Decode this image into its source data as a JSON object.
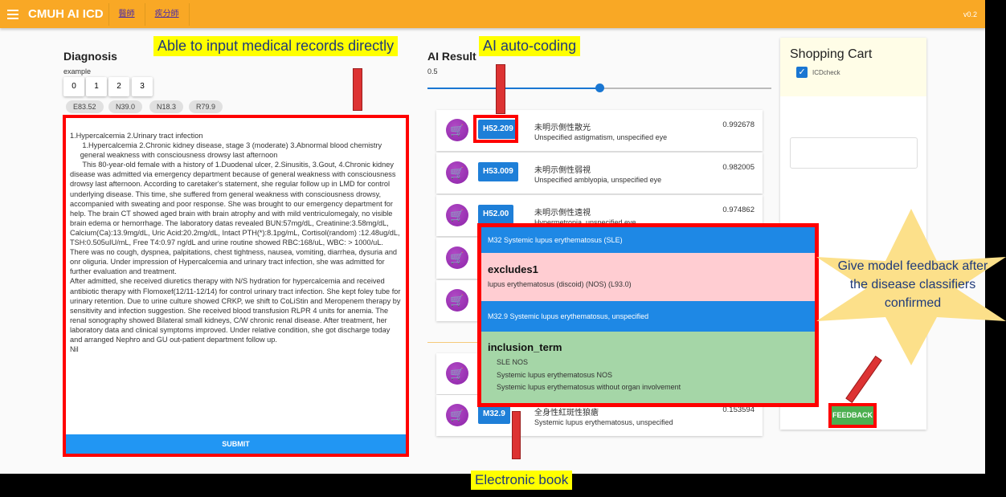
{
  "topbar": {
    "title": "CMUH AI ICD",
    "nav": [
      "醫師",
      "疾分師"
    ],
    "version": "v0.2"
  },
  "diagnosis": {
    "title": "Diagnosis",
    "example_label": "example",
    "examples": [
      "0",
      "1",
      "2",
      "3"
    ],
    "chips": [
      "E83.52",
      "N39.0",
      "N18.3",
      "R79.9"
    ],
    "text": "1.Hypercalcemia 2.Urinary tract infection\n      1.Hypercalcemia 2.Chronic kidney disease, stage 3 (moderate) 3.Abnormal blood chemistry\n     general weakness with consciousness drowsy last afternoon\n      This 80-year-old female with a history of 1.Duodenal ulcer, 2.Sinusitis, 3.Gout, 4.Chronic kidney disease was admitted via emergency department because of general weakness with consciousness drowsy last afternoon. According to caretaker's statement, she regular follow up in LMD for control underlying disease. This time, she suffered from general weakness with consciousness drowsy, accompanied with sweating and poor response. She was brought to our emergency department for help. The brain CT showed aged brain with brain atrophy and with mild ventriculomegaly, no visible brain edema or hemorrhage. The laboratory datas revealed BUN:57mg/dL, Creatinine:3.58mg/dL, Calcium(Ca):13.9mg/dL, Uric Acid:20.2mg/dL, Intact PTH(*):8.1pg/mL, Cortisol(random) :12.48ug/dL, TSH:0.505uIU/mL, Free T4:0.97 ng/dL and urine routine showed RBC:168/uL, WBC: > 1000/uL. There was no cough, dyspnea, palpitations, chest tightness, nausea, vomiting, diarrhea, dysuria and onr oliguria. Under impression of Hypercalcemia and urinary tract infection, she was admitted for further evaluation and treatment.\nAfter admitted, she received diuretics therapy with N/S hydration for hypercalcemia and received antibiotic therapy with Flomoxef(12/11-12/14) for control urinary tract infection. She kept foley tube for urinary retention. Due to urine culture showed CRKP, we shift to CoLiStin and Meropenem therapy by sensitivity and infection suggestion. She received blood transfusion RLPR 4 units for anemia. The renal sonography showed Bilateral small kidneys, C/W chronic renal disease. After treatment, her laboratory data and clinical symptoms improved. Under relative condition, she got discharge today and arranged Nephro and GU out-patient department follow up.\nNil",
    "submit_label": "SUBMIT"
  },
  "ai_result": {
    "title": "AI Result",
    "threshold_label": "0.5",
    "threshold_value": 0.5,
    "results": [
      {
        "code": "H52.209",
        "zh": "未明示側性散光",
        "en": "Unspecified astigmatism, unspecified eye",
        "score": "0.992678"
      },
      {
        "code": "H53.009",
        "zh": "未明示側性弱視",
        "en": "Unspecified amblyopia, unspecified eye",
        "score": "0.982005"
      },
      {
        "code": "H52.00",
        "zh": "未明示側性遠視",
        "en": "Hypermetropia, unspecified eye",
        "score": "0.974862"
      },
      {
        "code": "",
        "zh": "",
        "en": "",
        "score": ""
      },
      {
        "code": "",
        "zh": "",
        "en": "",
        "score": ""
      },
      {
        "code": "",
        "zh": "",
        "en": "",
        "score": ""
      },
      {
        "code": "M32.9",
        "zh": "全身性紅斑性狼瘡",
        "en": "Systemic lupus erythematosus, unspecified",
        "score": "0.153594"
      }
    ]
  },
  "ebook": {
    "parent": "M32 Systemic lupus erythematosus (SLE)",
    "excludes_title": "excludes1",
    "excludes": "lupus erythematosus (discoid) (NOS) (L93.0)",
    "child": "M32.9 Systemic lupus erythematosus, unspecified",
    "inclusion_title": "inclusion_term",
    "inclusions": [
      "SLE NOS",
      "Systemic lupus erythematosus NOS",
      "Systemic lupus erythematosus without organ involvement"
    ]
  },
  "cart": {
    "title": "Shopping Cart",
    "checkbox_label": "ICDcheck",
    "checked": true,
    "input_value": "",
    "feedback_label": "FEEDBACK"
  },
  "annotations": {
    "input": "Able to input medical records directly",
    "autocoding": "AI auto-coding",
    "ebook": "Electronic book",
    "feedback": "Give model feedback after the disease classifiers confirmed"
  },
  "colors": {
    "topbar": "#F9A825",
    "code_badge": "#1E7FD8",
    "cart_button": "#8E24AA",
    "excludes_bg": "#FFCDD2",
    "inclusion_bg": "#A5D6A7",
    "feedback": "#4CAF50",
    "callout": "#FFFF00"
  }
}
